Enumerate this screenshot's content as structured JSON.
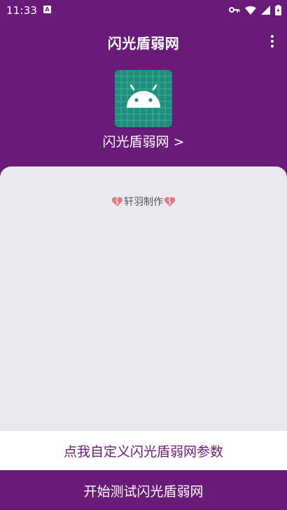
{
  "status_bar": {
    "time": "11:33",
    "notification_icon": "font-a-icon",
    "icons": [
      "key-icon",
      "wifi-icon",
      "signal-icon",
      "battery-icon"
    ]
  },
  "app_bar": {
    "title": "闪光盾弱网",
    "overflow_icon": "more-vert-icon"
  },
  "header": {
    "app_icon": "android-icon",
    "app_name": "闪光盾弱网 >"
  },
  "content": {
    "credit_text": "轩羽制作",
    "credit_icon": "broken-heart-icon"
  },
  "buttons": {
    "customize_label": "点我自定义闪光盾弱网参数",
    "start_label": "开始测试闪光盾弱网"
  },
  "colors": {
    "primary": "#6a1b7a",
    "card_background": "#e9e9ef",
    "icon_background": "#1f8f7d"
  }
}
